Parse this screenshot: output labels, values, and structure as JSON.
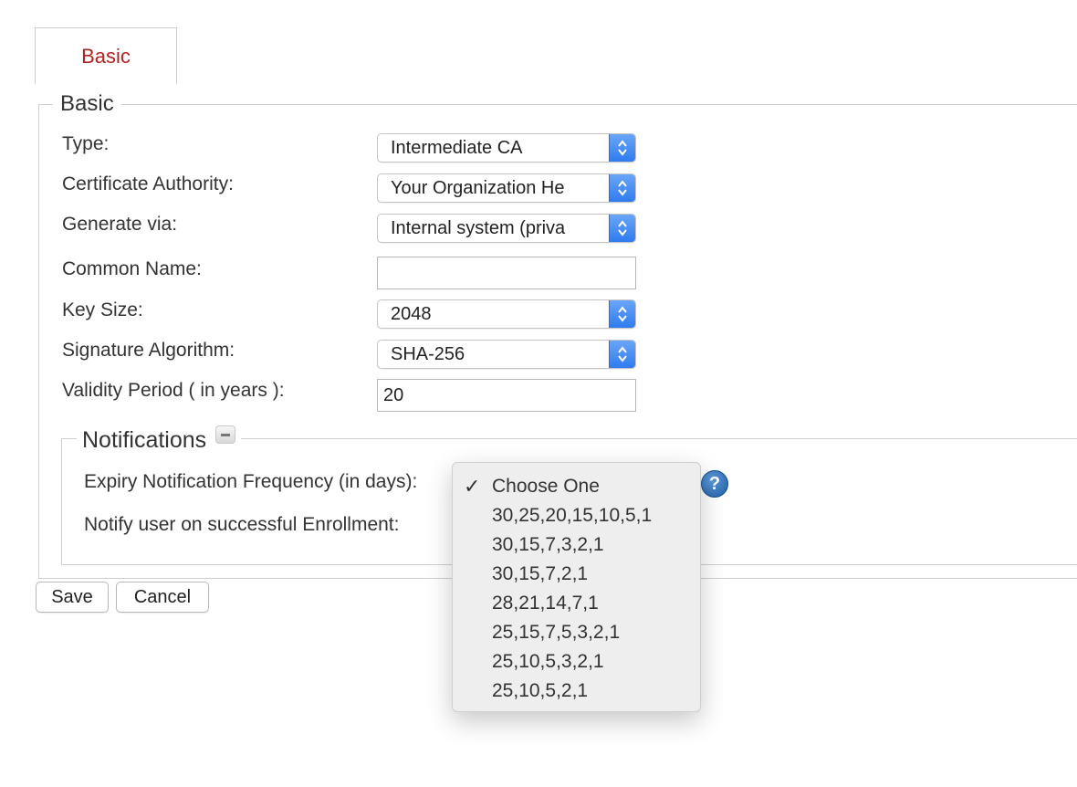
{
  "tab": {
    "label": "Basic"
  },
  "basic": {
    "legend": "Basic",
    "fields": {
      "type": {
        "label": "Type:",
        "value": "Intermediate CA"
      },
      "ca": {
        "label": "Certificate Authority:",
        "value": "Your Organization He"
      },
      "generate": {
        "label": "Generate via:",
        "value": "Internal system (priva"
      },
      "common_name": {
        "label": "Common Name:",
        "value": ""
      },
      "key_size": {
        "label": "Key Size:",
        "value": "2048"
      },
      "signature": {
        "label": "Signature Algorithm:",
        "value": "SHA-256"
      },
      "validity": {
        "label": "Validity Period ( in years ):",
        "value": "20"
      }
    }
  },
  "notifications": {
    "legend": "Notifications",
    "collapse_icon": "minus-icon",
    "expiry_label": "Expiry Notification Frequency (in days):",
    "notify_label": "Notify user on successful Enrollment:",
    "help_icon": "?"
  },
  "buttons": {
    "save": "Save",
    "cancel": "Cancel"
  },
  "dropdown": {
    "check": "✓",
    "options": [
      "Choose One",
      "30,25,20,15,10,5,1",
      "30,15,7,3,2,1",
      "30,15,7,2,1",
      "28,21,14,7,1",
      "25,15,7,5,3,2,1",
      "25,10,5,3,2,1",
      "25,10,5,2,1"
    ],
    "selected_index": 0
  },
  "colors": {
    "tab_text": "#b22222",
    "select_accent": "#2f7bf0",
    "help_icon": "#1f5ea8"
  }
}
